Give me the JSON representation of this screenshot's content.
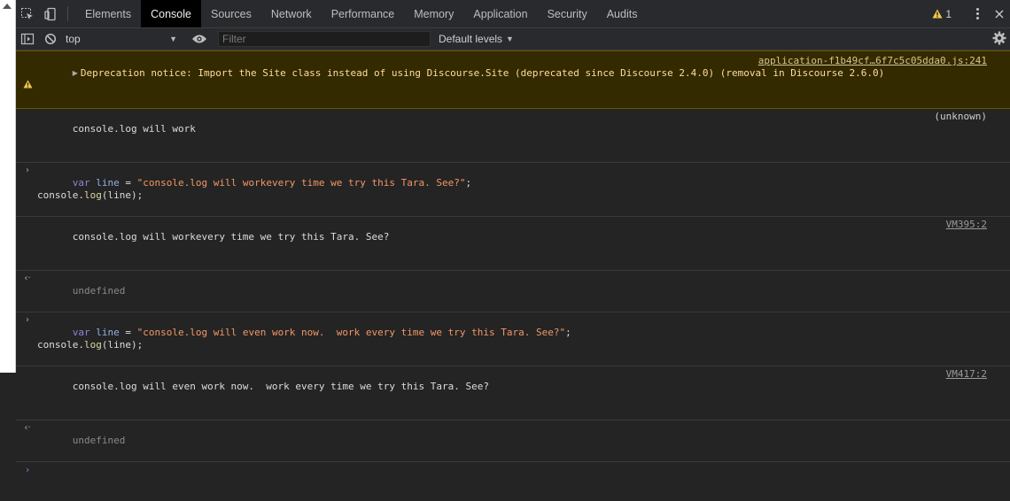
{
  "tabs": [
    {
      "label": "Elements"
    },
    {
      "label": "Console"
    },
    {
      "label": "Sources"
    },
    {
      "label": "Network"
    },
    {
      "label": "Performance"
    },
    {
      "label": "Memory"
    },
    {
      "label": "Application"
    },
    {
      "label": "Security"
    },
    {
      "label": "Audits"
    }
  ],
  "active_tab": "Console",
  "warning_count": "1",
  "toolbar": {
    "context": "top",
    "filter_placeholder": "Filter",
    "levels_label": "Default levels"
  },
  "messages": {
    "warning": {
      "text": "Deprecation notice: Import the Site class instead of using Discourse.Site (deprecated since Discourse 2.4.0) (removal in Discourse 2.6.0)",
      "source": "application-f1b49cf…6f7c5c05dda0.js:241"
    },
    "log1": {
      "text": "console.log will work",
      "source": "(unknown)"
    },
    "cmd1": {
      "kw": "var",
      "var": "line",
      "eq": " = ",
      "str": "\"console.log will workevery time we try this Tara. See?\"",
      "end": ";",
      "line2_a": "console.",
      "line2_fn": "log",
      "line2_b": "(line);"
    },
    "log2": {
      "text": "console.log will workevery time we try this Tara. See?",
      "source": "VM395:2"
    },
    "result1": "undefined",
    "cmd2": {
      "kw": "var",
      "var": "line",
      "eq": " = ",
      "str": "\"console.log will even work now.  work every time we try this Tara. See?\"",
      "end": ";",
      "line2_a": "console.",
      "line2_fn": "log",
      "line2_b": "(line);"
    },
    "log3": {
      "text": "console.log will even work now.  work every time we try this Tara. See?",
      "source": "VM417:2"
    },
    "result2": "undefined"
  },
  "colors": {
    "panel_bg": "#242424",
    "toolbar_bg": "#292a2d",
    "warning_bg": "#332a00",
    "warning_text": "#ffdd9e",
    "string": "#f29766",
    "keyword": "#9a7fd5",
    "variable": "#8fb2e0"
  }
}
